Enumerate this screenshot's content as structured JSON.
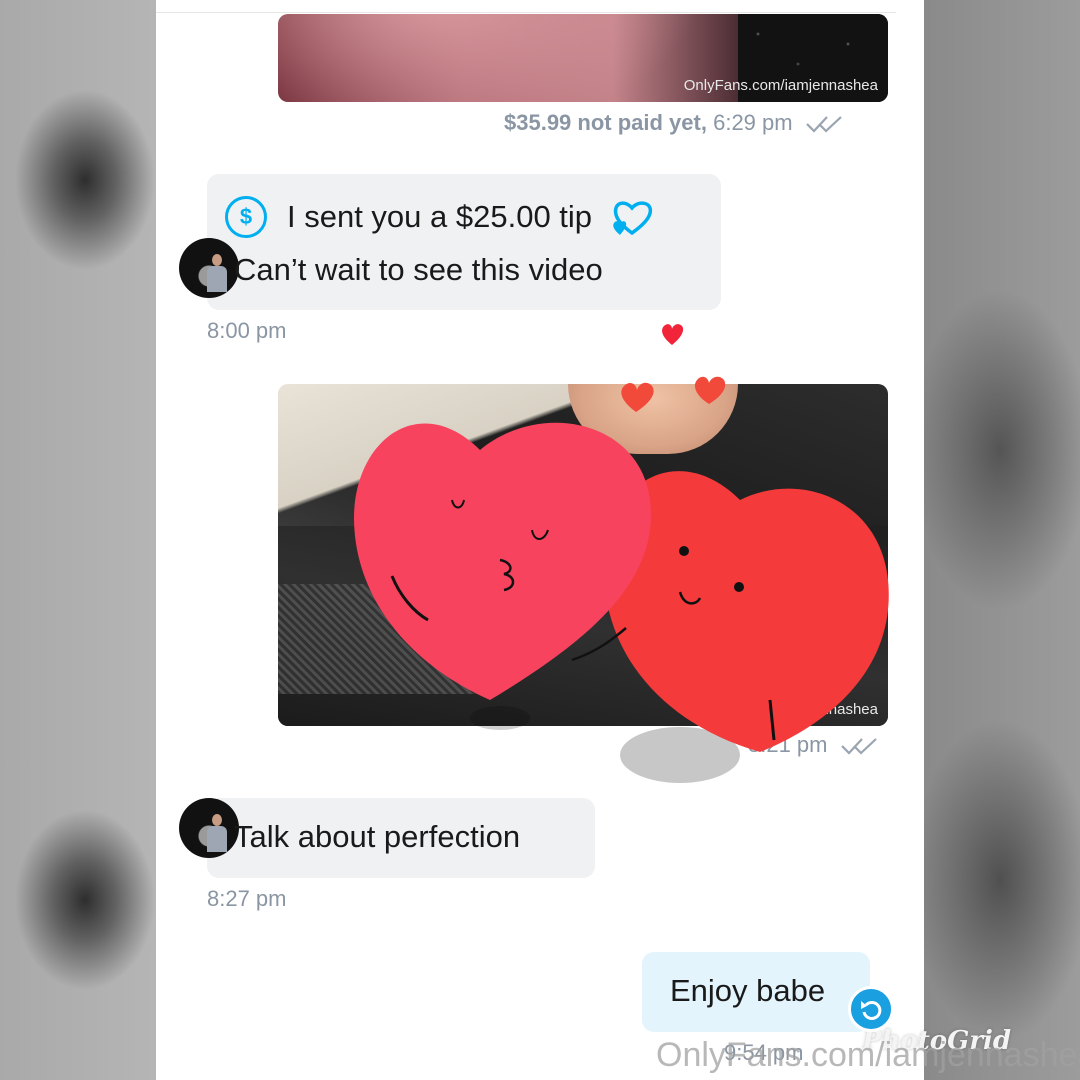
{
  "colors": {
    "accent": "#00aff0",
    "meta_text": "#8a96a3",
    "bubble_incoming": "#f0f1f3",
    "bubble_outgoing": "#e4f4fd",
    "heart_pink": "#f7435e",
    "heart_red": "#f43a3a"
  },
  "messages": {
    "media1": {
      "watermark": "OnlyFans.com/iamjennashea",
      "price": "$35.99 not paid yet,",
      "time": "6:29 pm"
    },
    "tip": {
      "tip_text": "I sent you a $25.00 tip",
      "message": "Can’t wait to see this video",
      "time": "8:00 pm"
    },
    "media2": {
      "watermark": "OnlyFans.com/iamjennashea",
      "time": "8:21 pm"
    },
    "incoming2": {
      "text": "Talk about perfection",
      "time": "8:27 pm"
    },
    "outgoing": {
      "text": "Enjoy babe",
      "time": "9:54 pm"
    }
  },
  "overlay": {
    "watermark": "OnlyFans.com/iamjennashea",
    "brand": "PhotoGrid"
  },
  "icons": [
    "dollar-circle-icon",
    "hearts-icon",
    "double-check-icon",
    "resend-icon",
    "heart-stickers"
  ]
}
